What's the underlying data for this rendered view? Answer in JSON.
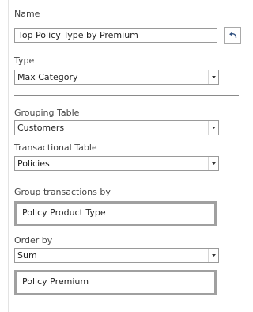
{
  "name": {
    "label": "Name",
    "value": "Top Policy Type by Premium"
  },
  "revert_button": {
    "icon": "undo-icon"
  },
  "type": {
    "label": "Type",
    "selected": "Max Category"
  },
  "grouping_table": {
    "label": "Grouping Table",
    "selected": "Customers"
  },
  "transactional_table": {
    "label": "Transactional Table",
    "selected": "Policies"
  },
  "group_by": {
    "label": "Group transactions by",
    "value": "Policy Product Type"
  },
  "order_by": {
    "label": "Order by",
    "selected": "Sum",
    "value": "Policy Premium"
  }
}
